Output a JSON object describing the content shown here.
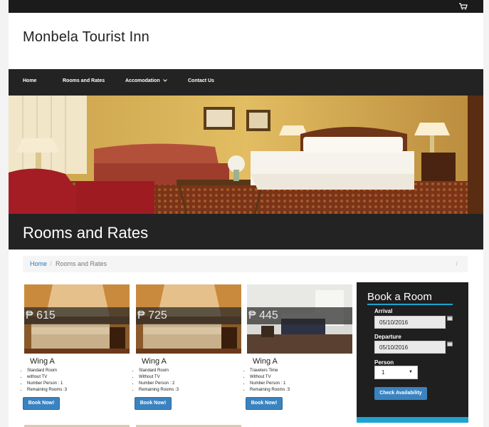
{
  "site": {
    "title": "Monbela Tourist Inn"
  },
  "topbar": {
    "cart_icon": "shopping-cart-icon"
  },
  "nav": {
    "items": [
      {
        "label": "Home"
      },
      {
        "label": "Rooms and Rates"
      },
      {
        "label": "Accomodation"
      },
      {
        "label": "Contact Us"
      }
    ]
  },
  "page": {
    "heading": "Rooms and Rates"
  },
  "breadcrumb": {
    "home": "Home",
    "separator": "/",
    "current": "Rooms and Rates",
    "trailing": "/"
  },
  "rooms": [
    {
      "price": "₱ 615",
      "name": "Wing A",
      "details": [
        "Standard Room",
        "without TV",
        "Number Person : 1",
        "Remaining Rooms :3"
      ],
      "button": "Book Now!"
    },
    {
      "price": "₱ 725",
      "name": "Wing A",
      "details": [
        "Standard Room",
        "Without TV",
        "Number Person : 2",
        "Remaining Rooms :3"
      ],
      "button": "Book Now!"
    },
    {
      "price": "₱ 445",
      "name": "Wing A",
      "details": [
        "Travelers Time",
        "Without TV",
        "Number Person : 1",
        "Remaining Rooms :3"
      ],
      "button": "Book Now!"
    }
  ],
  "booking": {
    "title": "Book a Room",
    "arrival_label": "Arrival",
    "arrival_value": "05/10/2016",
    "departure_label": "Departure",
    "departure_value": "05/10/2016",
    "person_label": "Person",
    "person_value": "1",
    "button": "Check Availability"
  },
  "colors": {
    "accent": "#1da3cf",
    "button": "#3a83c0",
    "dark": "#232323"
  }
}
